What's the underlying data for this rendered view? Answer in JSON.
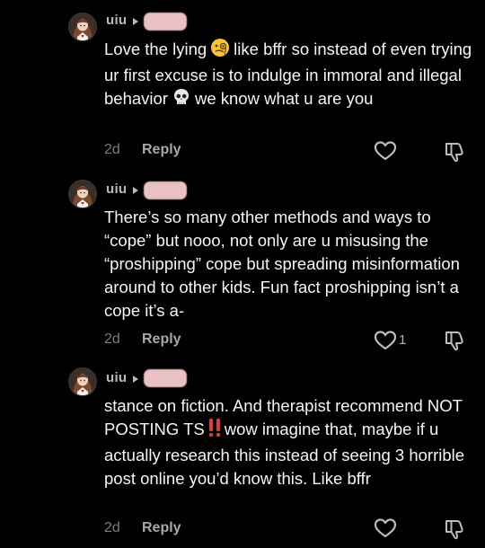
{
  "comments": [
    {
      "username": "uiu",
      "text_parts": [
        "Love the lying",
        "like bffr so instead of even trying ur first excuse is to indulge in immoral and illegal behavior",
        "we know what u are you"
      ],
      "emojis": [
        "face-with-monocle-emoji",
        "skull-emoji"
      ],
      "age": "2d",
      "reply_label": "Reply",
      "likes": ""
    },
    {
      "username": "uiu",
      "text": "There’s so many other methods and ways to “cope” but nooo, not only are u misusing the “proshipping” cope but spreading misinformation around to other kids. Fun fact proshipping isn’t a cope it’s a-",
      "age": "2d",
      "reply_label": "Reply",
      "likes": "1"
    },
    {
      "username": "uiu",
      "text_parts": [
        "stance on fiction. And therapist recommend NOT POSTING TS",
        "wow imagine that, maybe if u actually research this instead of seeing 3 horrible post online you’d know this. Like bffr"
      ],
      "emojis": [
        "double-exclamation-emoji"
      ],
      "age": "2d",
      "reply_label": "Reply",
      "likes": ""
    }
  ],
  "colors": {
    "background": "#000000",
    "text": "#f5f5f5",
    "username": "#b9b9b9",
    "muted": "#7c7c7c",
    "redaction": "#e9c0c3",
    "exclamation": "#e53935"
  },
  "icons": {
    "like": "heart-outline-icon",
    "dislike": "thumbs-down-outline-icon",
    "expand": "caret-right-icon"
  }
}
